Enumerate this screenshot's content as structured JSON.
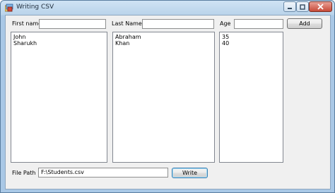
{
  "window": {
    "title": "Writing CSV"
  },
  "form": {
    "first_name_label": "First name",
    "last_name_label": "Last Name",
    "age_label": "Age",
    "first_name_value": "",
    "last_name_value": "",
    "age_value": "",
    "add_button": "Add",
    "first_names": [
      "John",
      "Sharukh"
    ],
    "last_names": [
      "Abraham",
      "Khan"
    ],
    "ages": [
      "35",
      "40"
    ],
    "file_path_label": "File Path",
    "file_path_value": "F:\\Students.csv",
    "write_button": "Write"
  },
  "colors": {
    "title_bar": "#b9d3ea",
    "close_button": "#c74a38",
    "form_bg": "#f0f0f0"
  }
}
